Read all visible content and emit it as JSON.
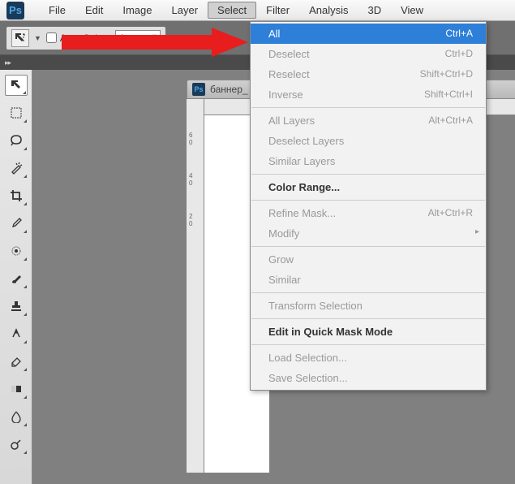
{
  "app": {
    "logo": "Ps"
  },
  "menubar": {
    "items": [
      "File",
      "Edit",
      "Image",
      "Layer",
      "Select",
      "Filter",
      "Analysis",
      "3D",
      "View"
    ],
    "active_index": 4
  },
  "options_bar": {
    "auto_select_label": "Auto-Select",
    "layer_dropdown": "Layer"
  },
  "document": {
    "title": "баннер_"
  },
  "select_menu": {
    "items": [
      {
        "label": "All",
        "shortcut": "Ctrl+A",
        "highlighted": true
      },
      {
        "label": "Deselect",
        "shortcut": "Ctrl+D",
        "disabled": true
      },
      {
        "label": "Reselect",
        "shortcut": "Shift+Ctrl+D",
        "disabled": true
      },
      {
        "label": "Inverse",
        "shortcut": "Shift+Ctrl+I",
        "disabled": true
      },
      {
        "sep": true
      },
      {
        "label": "All Layers",
        "shortcut": "Alt+Ctrl+A",
        "disabled": true
      },
      {
        "label": "Deselect Layers",
        "disabled": true
      },
      {
        "label": "Similar Layers",
        "disabled": true
      },
      {
        "sep": true
      },
      {
        "label": "Color Range...",
        "bold": true
      },
      {
        "sep": true
      },
      {
        "label": "Refine Mask...",
        "shortcut": "Alt+Ctrl+R",
        "disabled": true
      },
      {
        "label": "Modify",
        "disabled": true,
        "submenu": true
      },
      {
        "sep": true
      },
      {
        "label": "Grow",
        "disabled": true
      },
      {
        "label": "Similar",
        "disabled": true
      },
      {
        "sep": true
      },
      {
        "label": "Transform Selection",
        "disabled": true
      },
      {
        "sep": true
      },
      {
        "label": "Edit in Quick Mask Mode",
        "bold": true
      },
      {
        "sep": true
      },
      {
        "label": "Load Selection...",
        "disabled": true
      },
      {
        "label": "Save Selection...",
        "disabled": true
      }
    ]
  },
  "tools": [
    "move",
    "marquee",
    "lasso",
    "wand",
    "crop",
    "eyedropper",
    "healing",
    "brush",
    "stamp",
    "history",
    "eraser",
    "gradient",
    "blur",
    "dodge"
  ]
}
